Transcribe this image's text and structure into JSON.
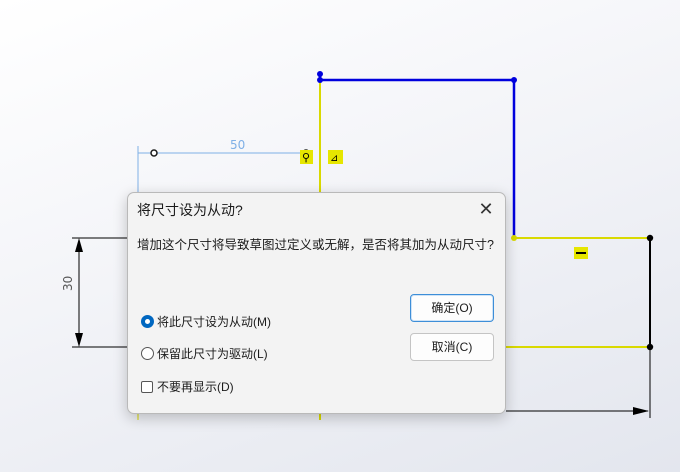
{
  "sketch": {
    "dimension_horizontal": "50",
    "dimension_vertical": "30",
    "colors": {
      "construction_blue": "#0000dd",
      "selected_yellow": "#d9d900",
      "dimension_line": "#7fb0e6",
      "black": "#000000"
    }
  },
  "dialog": {
    "title": "将尺寸设为从动?",
    "message": "增加这个尺寸将导致草图过定义或无解，是否将其加为从动尺寸?",
    "options": [
      {
        "label": "将此尺寸设为从动(M)",
        "checked": true
      },
      {
        "label": "保留此尺寸为驱动(L)",
        "checked": false
      }
    ],
    "dont_show_label": "不要再显示(D)",
    "dont_show_checked": false,
    "ok_label": "确定(O)",
    "cancel_label": "取消(C)",
    "close_icon": "close-icon"
  }
}
